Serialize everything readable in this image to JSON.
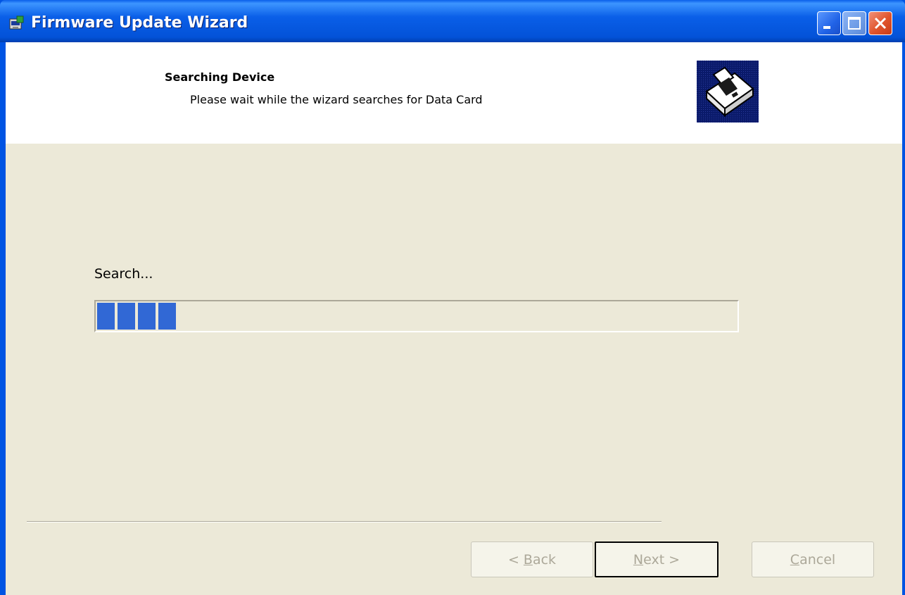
{
  "window": {
    "title": "Firmware Update Wizard",
    "icon": "wizard-app-icon",
    "controls": {
      "minimize": "minimize-icon",
      "maximize": "maximize-icon",
      "close": "close-icon"
    }
  },
  "header": {
    "title": "Searching Device",
    "subtitle": "Please wait while the wizard searches for Data Card",
    "image": "device-search-icon"
  },
  "main": {
    "status_label": "Search...",
    "progress": {
      "segments_filled": 4,
      "fraction": 0.125,
      "color": "#3168d5"
    }
  },
  "buttons": {
    "back": {
      "prefix": "< ",
      "mnemonic": "B",
      "rest": "ack",
      "enabled": false
    },
    "next": {
      "mnemonic": "N",
      "rest": "ext >",
      "enabled": false
    },
    "cancel": {
      "mnemonic": "C",
      "rest": "ancel",
      "enabled": false
    }
  },
  "colors": {
    "title_bar": "#0a5fe8",
    "dialog_background": "#ece9d8",
    "header_background": "#ffffff",
    "disabled_text": "#aca899"
  }
}
